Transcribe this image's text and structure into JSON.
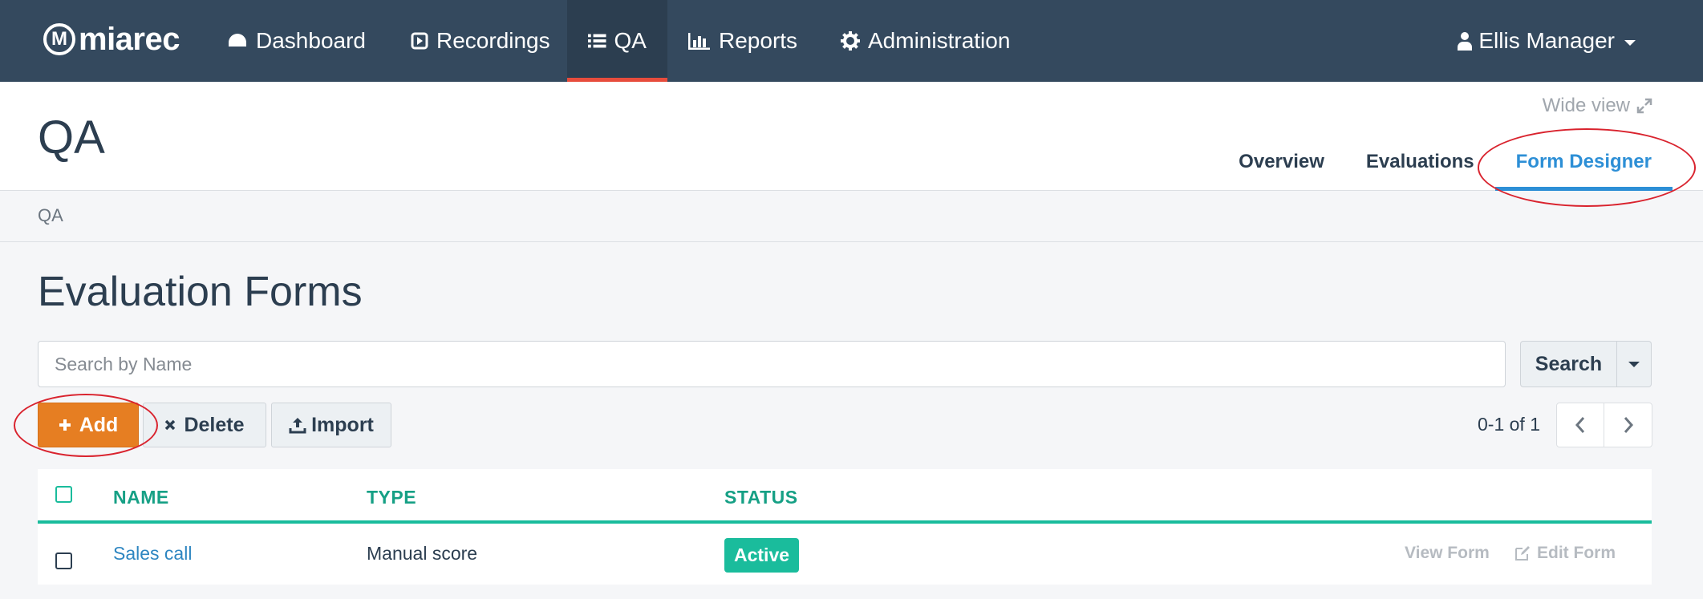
{
  "nav": {
    "brand": "miarec",
    "items": [
      {
        "label": "Dashboard",
        "icon": "dashboard-icon"
      },
      {
        "label": "Recordings",
        "icon": "play-icon"
      },
      {
        "label": "QA",
        "icon": "list-icon",
        "active": true
      },
      {
        "label": "Reports",
        "icon": "bar-chart-icon"
      },
      {
        "label": "Administration",
        "icon": "gear-icon"
      }
    ],
    "user": "Ellis Manager"
  },
  "header": {
    "title": "QA",
    "wide_view": "Wide view",
    "tabs": [
      {
        "label": "Overview"
      },
      {
        "label": "Evaluations"
      },
      {
        "label": "Form Designer",
        "active": true
      }
    ]
  },
  "breadcrumb": "QA",
  "section_title": "Evaluation Forms",
  "search": {
    "placeholder": "Search by Name",
    "button": "Search"
  },
  "actions": {
    "add": "Add",
    "delete": "Delete",
    "import": "Import"
  },
  "pager": "0-1 of 1",
  "table": {
    "columns": [
      "NAME",
      "TYPE",
      "STATUS"
    ],
    "rows": [
      {
        "name": "Sales call",
        "type": "Manual score",
        "status": "Active",
        "view": "View Form",
        "edit": "Edit Form"
      }
    ]
  },
  "colors": {
    "nav_bg": "#34495e",
    "accent_teal": "#1abc9c",
    "accent_orange": "#e67e22",
    "accent_blue": "#2d8fd6",
    "annotation_red": "#d9232e"
  }
}
